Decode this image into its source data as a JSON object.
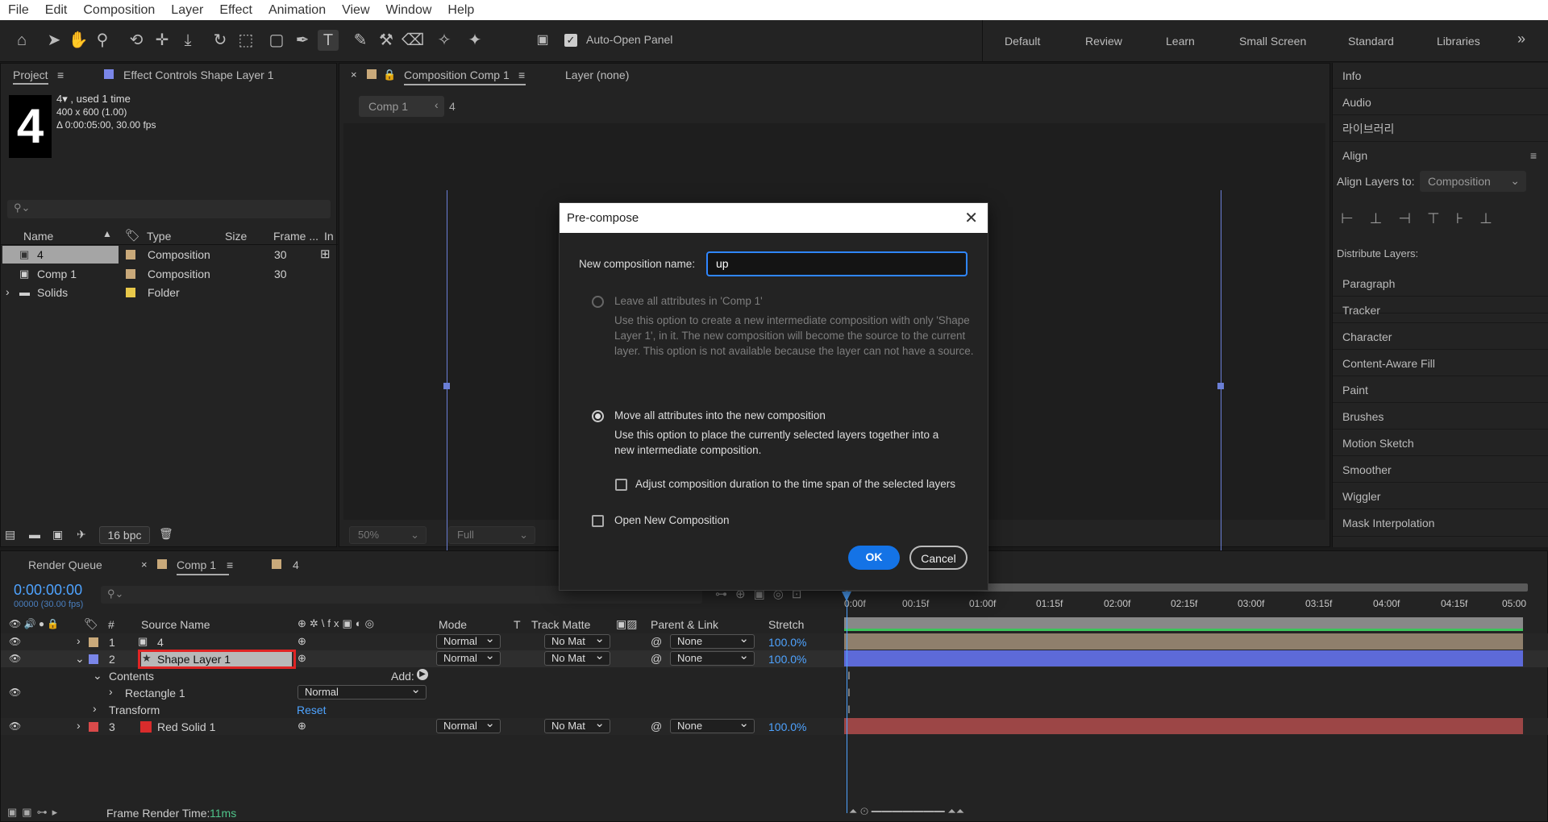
{
  "menu": [
    "File",
    "Edit",
    "Composition",
    "Layer",
    "Effect",
    "Animation",
    "View",
    "Window",
    "Help"
  ],
  "toolbar": {
    "auto_open_label": "Auto-Open Panel",
    "workspaces": [
      "Default",
      "Review",
      "Learn",
      "Small Screen",
      "Standard",
      "Libraries"
    ],
    "more": "»"
  },
  "project_panel": {
    "tab_label": "Project",
    "effect_controls_label": "Effect Controls Shape Layer 1",
    "thumb_text": "4",
    "info_line1": "4▾ , used 1 time",
    "info_line2": "400 x 600 (1.00)",
    "info_line3": "Δ 0:00:05:00, 30.00 fps",
    "columns": [
      "Name",
      "Type",
      "Size",
      "Frame ...",
      "In"
    ],
    "rows": [
      {
        "name": "4",
        "type": "Composition",
        "frame": "30",
        "color": "#c9a97a"
      },
      {
        "name": "Comp 1",
        "type": "Composition",
        "frame": "30",
        "color": "#c9a97a"
      },
      {
        "name": "Solids",
        "type": "Folder",
        "frame": "",
        "color": "#e8c84a"
      }
    ],
    "bpc": "16 bpc"
  },
  "comp_panel": {
    "tab_label": "Composition Comp 1",
    "layer_tab": "Layer (none)",
    "breadcrumb_comp": "Comp 1",
    "breadcrumb_next": "4",
    "zoom": "50%",
    "resolution": "Full"
  },
  "right_panels": [
    "Info",
    "Audio",
    "라이브러리",
    "Align",
    "Paragraph",
    "Tracker",
    "Character",
    "Content-Aware Fill",
    "Paint",
    "Brushes",
    "Motion Sketch",
    "Smoother",
    "Wiggler",
    "Mask Interpolation"
  ],
  "align": {
    "align_to_label": "Align Layers to:",
    "align_to_value": "Composition",
    "distribute_label": "Distribute Layers:"
  },
  "timeline": {
    "render_queue_tab": "Render Queue",
    "comp_tab": "Comp 1",
    "comp4_tab": "4",
    "timecode": "0:00:00:00",
    "timecode_sub": "00000 (30.00 fps)",
    "columns": {
      "source": "Source Name",
      "mode": "Mode",
      "t": "T",
      "track": "Track Matte",
      "parent": "Parent & Link",
      "stretch": "Stretch",
      "num": "#"
    },
    "ruler": [
      "0:00f",
      "00:15f",
      "01:00f",
      "01:15f",
      "02:00f",
      "02:15f",
      "03:00f",
      "03:15f",
      "04:00f",
      "04:15f",
      "05:00"
    ],
    "layers": [
      {
        "num": "1",
        "name": "4",
        "mode": "Normal",
        "track": "No Mat",
        "parent": "None",
        "stretch": "100.0%",
        "color": "#c9a97a"
      },
      {
        "num": "2",
        "name": "Shape Layer 1",
        "mode": "Normal",
        "track": "No Mat",
        "parent": "None",
        "stretch": "100.0%",
        "color": "#7a86e8"
      },
      {
        "num": "3",
        "name": "Red Solid 1",
        "mode": "Normal",
        "track": "No Mat",
        "parent": "None",
        "stretch": "100.0%",
        "color": "#d94a4a"
      }
    ],
    "contents_label": "Contents",
    "add_label": "Add:",
    "rectangle_label": "Rectangle 1",
    "rectangle_mode": "Normal",
    "transform_label": "Transform",
    "reset_label": "Reset",
    "render_time_label": "Frame Render Time:",
    "render_time_value": "11ms"
  },
  "dialog": {
    "title": "Pre-compose",
    "name_label": "New composition name:",
    "name_value": "up",
    "option1_label": "Leave all attributes in 'Comp 1'",
    "option1_desc": "Use this option to create a new intermediate composition with only 'Shape Layer 1', in it. The new composition will become the source to the current layer. This option is not available because the layer can not have a source.",
    "option2_label": "Move all attributes into the new composition",
    "option2_desc": "Use this option to place the currently selected layers together into a new intermediate composition.",
    "adjust_label": "Adjust composition duration to the time span of the selected layers",
    "open_label": "Open New Composition",
    "ok": "OK",
    "cancel": "Cancel"
  }
}
